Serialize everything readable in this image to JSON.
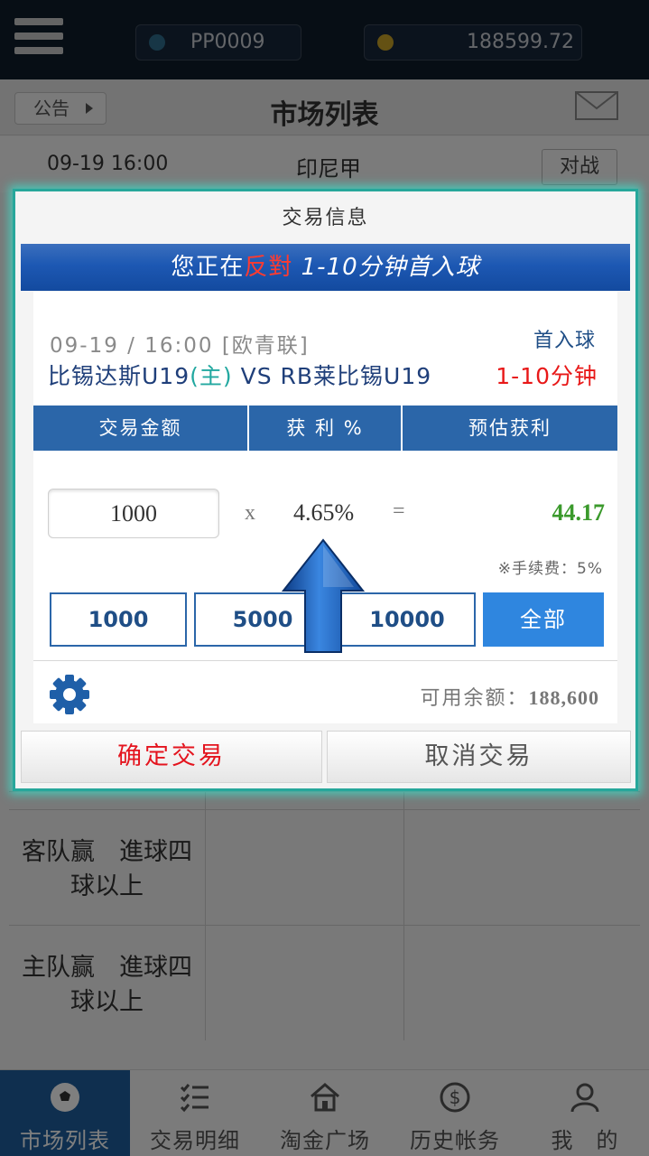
{
  "topbar": {
    "username": "PP0009",
    "balance": "188599.72"
  },
  "subbar": {
    "notice_label": "公告",
    "page_title": "市场列表"
  },
  "match_row": {
    "datetime": "09-19 16:00",
    "league": "印尼甲",
    "vs_button": "对战"
  },
  "grid_rows": [
    {
      "line1": "客队赢",
      "line2": "進球四",
      "line3": "球以上"
    },
    {
      "line1": "主队赢",
      "line2": "進球四",
      "line3": "球以上"
    }
  ],
  "bottom_nav": [
    {
      "label": "市场列表",
      "icon": "soccer-ball-icon",
      "active": true
    },
    {
      "label": "交易明细",
      "icon": "checklist-icon",
      "active": false
    },
    {
      "label": "淘金广场",
      "icon": "home-icon",
      "active": false
    },
    {
      "label": "历史帐务",
      "icon": "dollar-icon",
      "active": false
    },
    {
      "label": "我　的",
      "icon": "user-icon",
      "active": false
    }
  ],
  "modal": {
    "title": "交易信息",
    "banner_prefix": "您正在",
    "banner_action": "反對",
    "banner_market": "1-10分钟首入球",
    "datetime": "09-19 / 16:00",
    "league": "[欧青联]",
    "market_type": "首入球",
    "home_team": "比锡达斯U19",
    "home_tag": "(主)",
    "vs": "VS",
    "away_team": "RB莱比锡U19",
    "selection": "1-10分钟",
    "headers": {
      "amount": "交易金额",
      "profit_rate": "获 利 %",
      "est_profit": "预估获利"
    },
    "amount_value": "1000",
    "multiply": "x",
    "rate": "4.65%",
    "equals": "=",
    "est_profit": "44.17",
    "fee_note": "※手续费：5%",
    "quick_amounts": [
      "1000",
      "5000",
      "10000"
    ],
    "all_label": "全部",
    "available_label": "可用余额：",
    "available_value": "188,600",
    "confirm_label": "确定交易",
    "cancel_label": "取消交易"
  },
  "colors": {
    "modal_glow": "#27a79b",
    "banner_blue": "#1d58b3",
    "table_header_blue": "#2b66a9",
    "all_button_blue": "#2f86df",
    "profit_green": "#3b9a2c",
    "selection_red": "#e81818"
  }
}
